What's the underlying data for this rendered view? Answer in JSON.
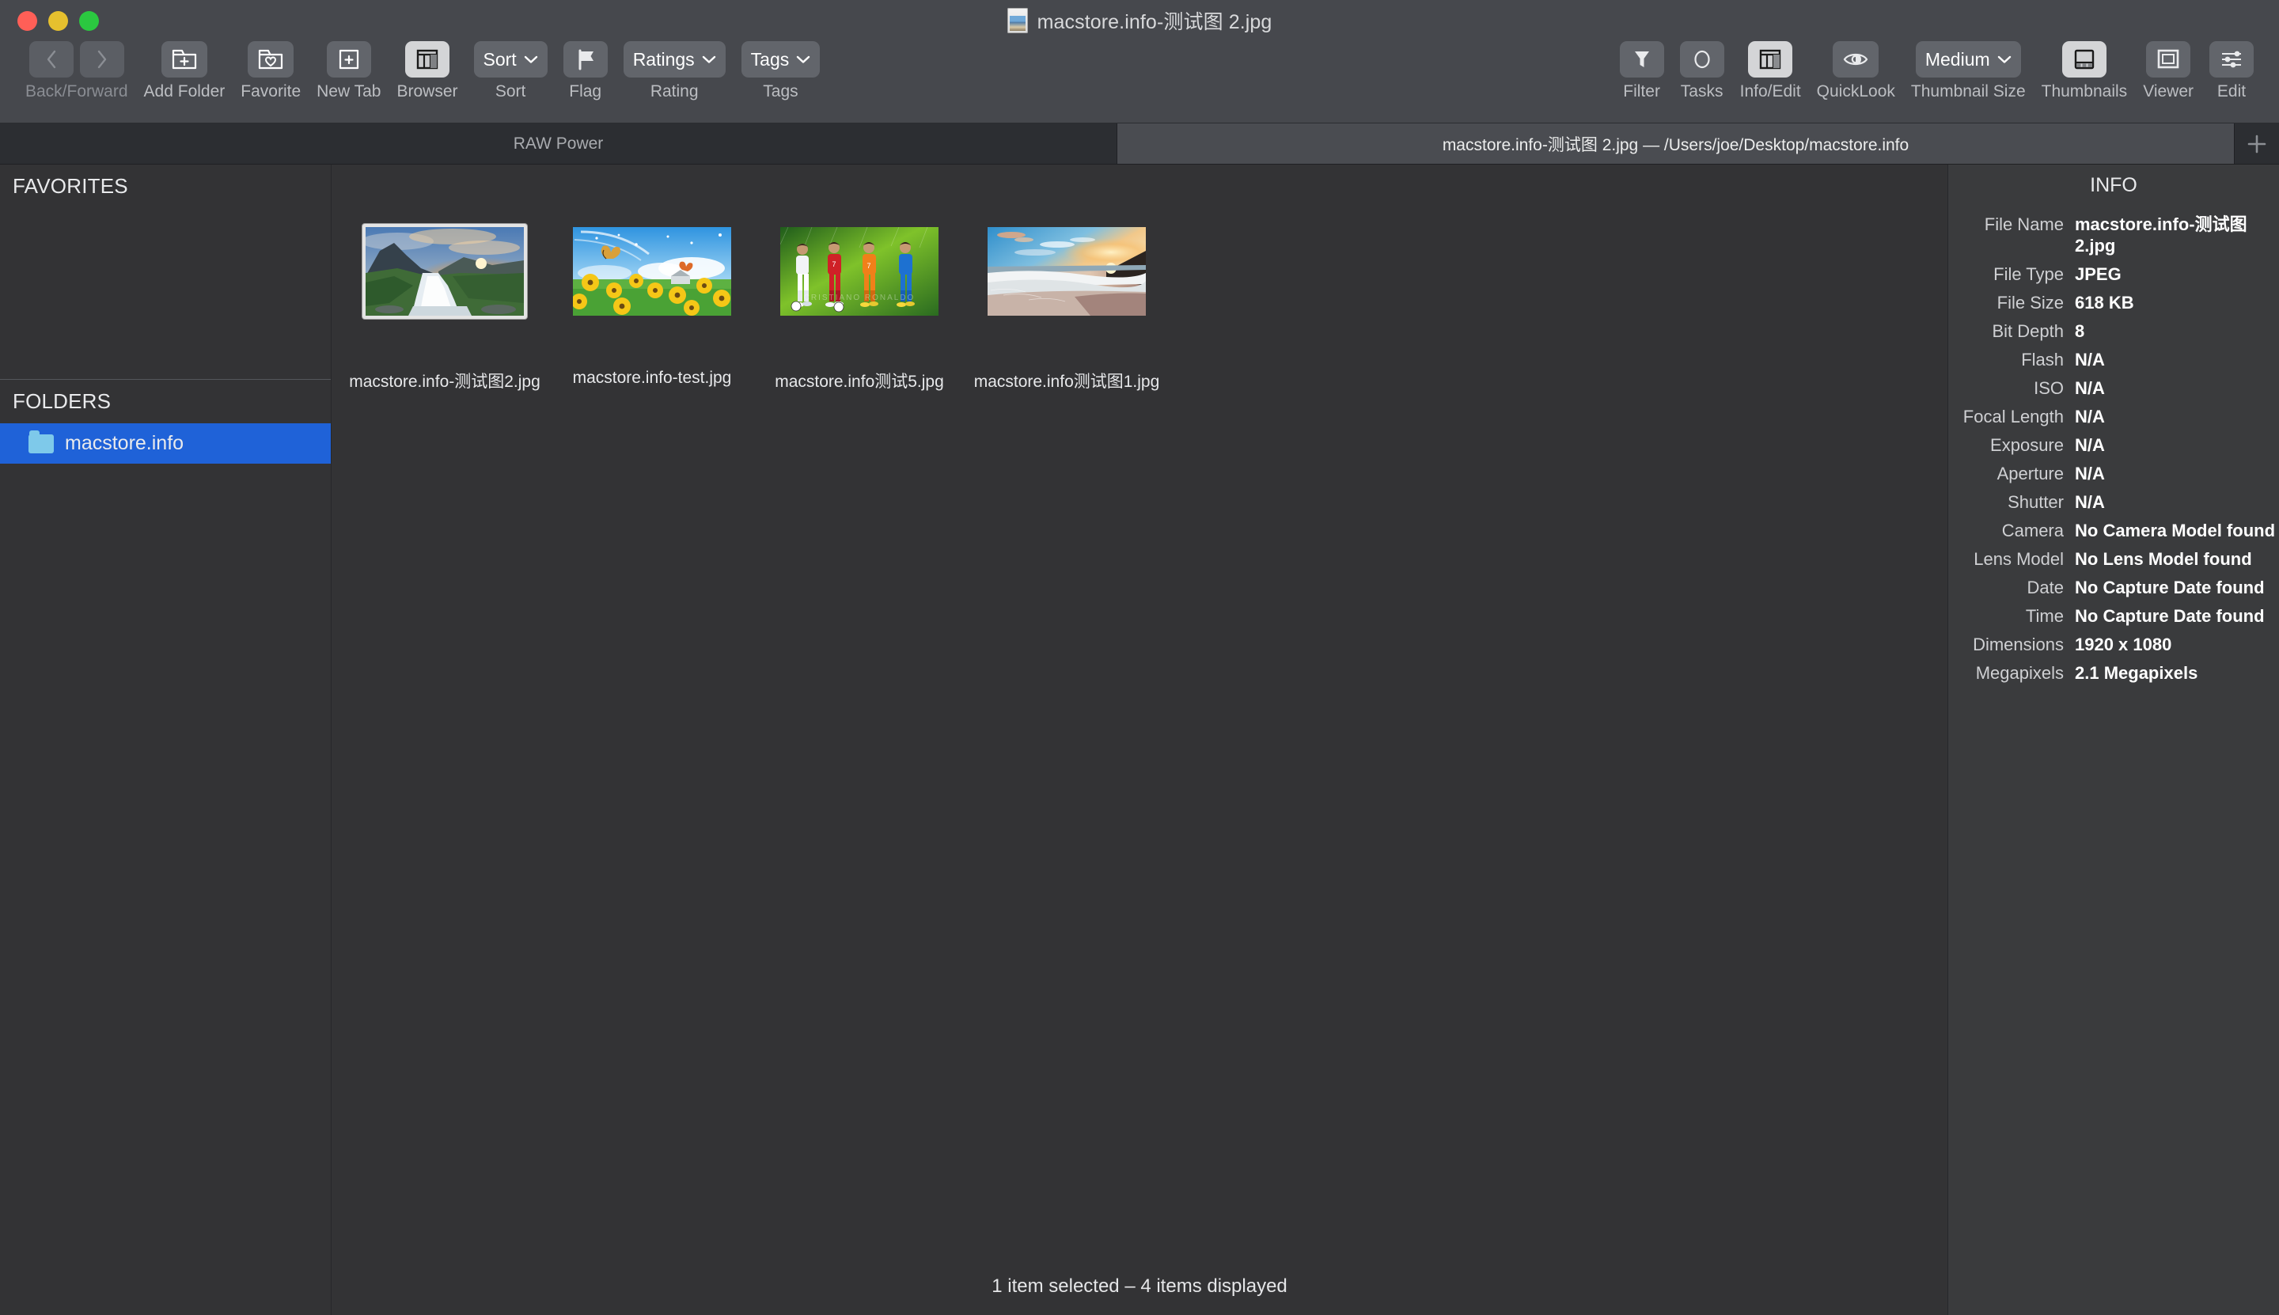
{
  "window": {
    "title": "macstore.info-测试图 2.jpg",
    "title_icon": "jpeg-document-icon"
  },
  "toolbar": {
    "left_groups": [
      {
        "label": "Back/Forward",
        "name": "back-forward",
        "icons": [
          "chevron-left-icon",
          "chevron-right-icon"
        ],
        "active": false,
        "disabled": true
      },
      {
        "label": "Add Folder",
        "name": "add-folder",
        "icons": [
          "folder-plus-icon"
        ],
        "active": false
      },
      {
        "label": "Favorite",
        "name": "favorite",
        "icons": [
          "folder-heart-icon"
        ],
        "active": false
      },
      {
        "label": "New Tab",
        "name": "new-tab",
        "icons": [
          "file-plus-icon"
        ],
        "active": false
      },
      {
        "label": "Browser",
        "name": "browser",
        "icons": [
          "browser-layout-icon"
        ],
        "active": true
      },
      {
        "label": "Sort",
        "name": "sort",
        "menu": "Sort",
        "icons": [
          "chevron-down-icon"
        ],
        "active": false
      },
      {
        "label": "Flag",
        "name": "flag",
        "icons": [
          "flag-icon"
        ],
        "active": false
      },
      {
        "label": "Rating",
        "name": "rating",
        "menu": "Ratings",
        "icons": [
          "chevron-down-icon"
        ],
        "active": false
      },
      {
        "label": "Tags",
        "name": "tags",
        "menu": "Tags",
        "icons": [
          "chevron-down-icon"
        ],
        "active": false
      }
    ],
    "right_groups": [
      {
        "label": "Filter",
        "name": "filter",
        "icons": [
          "funnel-icon"
        ],
        "active": false
      },
      {
        "label": "Tasks",
        "name": "tasks",
        "icons": [
          "circle-icon"
        ],
        "active": false
      },
      {
        "label": "Info/Edit",
        "name": "info-edit",
        "icons": [
          "panel-layout-icon"
        ],
        "active": true
      },
      {
        "label": "QuickLook",
        "name": "quicklook",
        "icons": [
          "eye-icon"
        ],
        "active": false
      },
      {
        "label": "Thumbnail Size",
        "name": "thumbnail-size",
        "menu": "Medium",
        "icons": [
          "chevron-down-icon"
        ],
        "active": false
      },
      {
        "label": "Thumbnails",
        "name": "thumbnails",
        "icons": [
          "thumbnails-strip-icon"
        ],
        "active": true
      },
      {
        "label": "Viewer",
        "name": "viewer",
        "icons": [
          "viewer-frame-icon"
        ],
        "active": false
      },
      {
        "label": "Edit",
        "name": "edit",
        "icons": [
          "sliders-icon"
        ],
        "active": false
      }
    ]
  },
  "tabs": [
    {
      "label": "RAW Power",
      "active": false
    },
    {
      "label": "macstore.info-测试图 2.jpg  —  /Users/joe/Desktop/macstore.info",
      "active": true
    }
  ],
  "tab_add_icon": "plus-icon",
  "sidebar": {
    "favorites_header": "FAVORITES",
    "favorites_items": [],
    "folders_header": "FOLDERS",
    "folders_items": [
      {
        "label": "macstore.info",
        "selected": true,
        "icon": "folder-icon"
      }
    ]
  },
  "browser": {
    "items": [
      {
        "label": "macstore.info-测试图2.jpg",
        "selected": true,
        "thumb": "waterfall-mountain-sunset"
      },
      {
        "label": "macstore.info-test.jpg",
        "selected": false,
        "thumb": "yellow-flowers-butterfly-sky"
      },
      {
        "label": "macstore.info测试5.jpg",
        "selected": false,
        "thumb": "four-soccer-players-green-field"
      },
      {
        "label": "macstore.info测试图1.jpg",
        "selected": false,
        "thumb": "beach-sunset-shoreline"
      }
    ],
    "status": "1 item selected – 4 items displayed"
  },
  "info": {
    "title": "INFO",
    "rows": [
      {
        "key": "File Name",
        "value": "macstore.info-测试图2.jpg"
      },
      {
        "key": "File Type",
        "value": "JPEG"
      },
      {
        "key": "File Size",
        "value": "618 KB"
      },
      {
        "key": "Bit Depth",
        "value": "8"
      },
      {
        "key": "Flash",
        "value": "N/A"
      },
      {
        "key": "ISO",
        "value": "N/A"
      },
      {
        "key": "Focal Length",
        "value": "N/A"
      },
      {
        "key": "Exposure",
        "value": "N/A"
      },
      {
        "key": "Aperture",
        "value": "N/A"
      },
      {
        "key": "Shutter",
        "value": "N/A"
      },
      {
        "key": "Camera",
        "value": "No Camera Model found"
      },
      {
        "key": "Lens Model",
        "value": "No Lens Model found"
      },
      {
        "key": "Date",
        "value": "No Capture Date found"
      },
      {
        "key": "Time",
        "value": "No Capture Date found"
      },
      {
        "key": "Dimensions",
        "value": "1920 x 1080"
      },
      {
        "key": "Megapixels",
        "value": "2.1 Megapixels"
      }
    ]
  },
  "colors": {
    "toolbar_bg": "#46484d",
    "content_bg": "#333335",
    "info_bg": "#3a3b3d",
    "selection_blue": "#1f62d8",
    "active_button": "#d4d5d7"
  }
}
